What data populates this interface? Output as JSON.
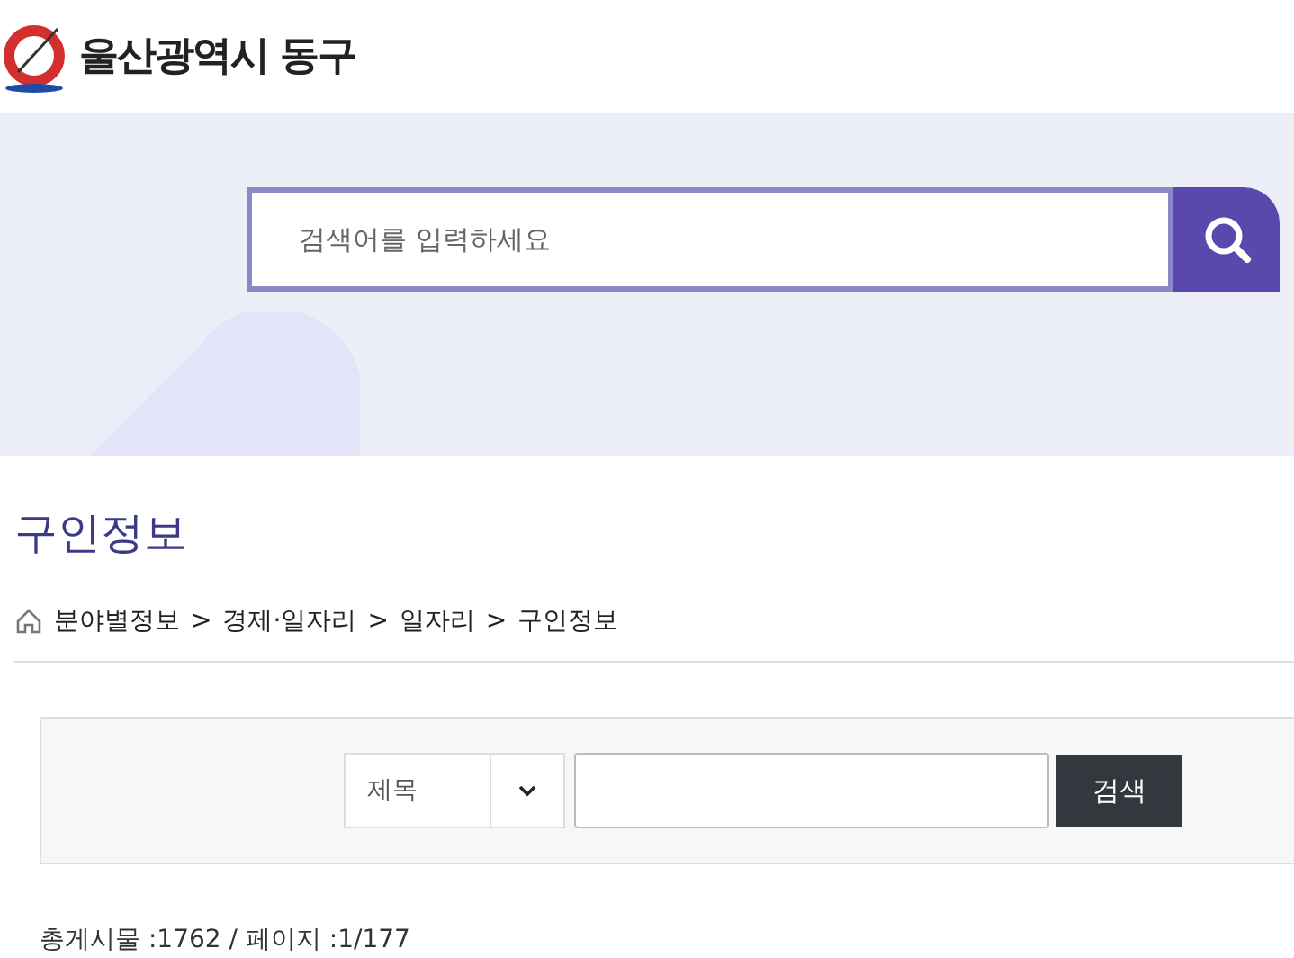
{
  "header": {
    "site_name": "울산광역시 동구"
  },
  "banner_search": {
    "placeholder": "검색어를 입력하세요"
  },
  "page_title": "구인정보",
  "breadcrumb": {
    "separator": ">",
    "items": [
      "분야별정보",
      "경제·일자리",
      "일자리",
      "구인정보"
    ]
  },
  "board_search": {
    "field_select": "제목",
    "button": "검색"
  },
  "summary": "총게시물 :1762 / 페이지 :1/177"
}
